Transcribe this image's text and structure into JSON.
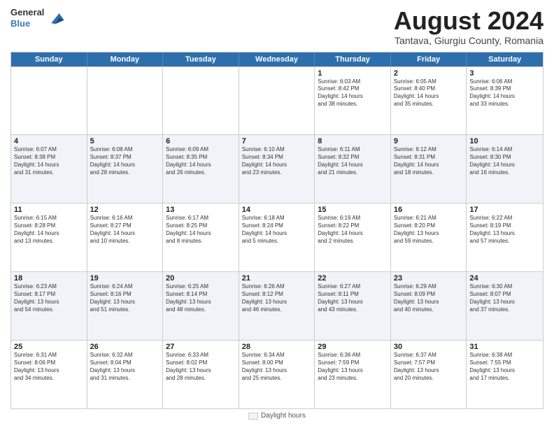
{
  "header": {
    "logo_general": "General",
    "logo_blue": "Blue",
    "title": "August 2024",
    "location": "Tantava, Giurgiu County, Romania"
  },
  "weekdays": [
    "Sunday",
    "Monday",
    "Tuesday",
    "Wednesday",
    "Thursday",
    "Friday",
    "Saturday"
  ],
  "rows": [
    [
      {
        "day": "",
        "text": ""
      },
      {
        "day": "",
        "text": ""
      },
      {
        "day": "",
        "text": ""
      },
      {
        "day": "",
        "text": ""
      },
      {
        "day": "1",
        "text": "Sunrise: 6:03 AM\nSunset: 8:42 PM\nDaylight: 14 hours\nand 38 minutes."
      },
      {
        "day": "2",
        "text": "Sunrise: 6:05 AM\nSunset: 8:40 PM\nDaylight: 14 hours\nand 35 minutes."
      },
      {
        "day": "3",
        "text": "Sunrise: 6:06 AM\nSunset: 8:39 PM\nDaylight: 14 hours\nand 33 minutes."
      }
    ],
    [
      {
        "day": "4",
        "text": "Sunrise: 6:07 AM\nSunset: 8:38 PM\nDaylight: 14 hours\nand 31 minutes."
      },
      {
        "day": "5",
        "text": "Sunrise: 6:08 AM\nSunset: 8:37 PM\nDaylight: 14 hours\nand 28 minutes."
      },
      {
        "day": "6",
        "text": "Sunrise: 6:09 AM\nSunset: 8:35 PM\nDaylight: 14 hours\nand 26 minutes."
      },
      {
        "day": "7",
        "text": "Sunrise: 6:10 AM\nSunset: 8:34 PM\nDaylight: 14 hours\nand 23 minutes."
      },
      {
        "day": "8",
        "text": "Sunrise: 6:11 AM\nSunset: 8:32 PM\nDaylight: 14 hours\nand 21 minutes."
      },
      {
        "day": "9",
        "text": "Sunrise: 6:12 AM\nSunset: 8:31 PM\nDaylight: 14 hours\nand 18 minutes."
      },
      {
        "day": "10",
        "text": "Sunrise: 6:14 AM\nSunset: 8:30 PM\nDaylight: 14 hours\nand 16 minutes."
      }
    ],
    [
      {
        "day": "11",
        "text": "Sunrise: 6:15 AM\nSunset: 8:28 PM\nDaylight: 14 hours\nand 13 minutes."
      },
      {
        "day": "12",
        "text": "Sunrise: 6:16 AM\nSunset: 8:27 PM\nDaylight: 14 hours\nand 10 minutes."
      },
      {
        "day": "13",
        "text": "Sunrise: 6:17 AM\nSunset: 8:25 PM\nDaylight: 14 hours\nand 8 minutes."
      },
      {
        "day": "14",
        "text": "Sunrise: 6:18 AM\nSunset: 8:24 PM\nDaylight: 14 hours\nand 5 minutes."
      },
      {
        "day": "15",
        "text": "Sunrise: 6:19 AM\nSunset: 8:22 PM\nDaylight: 14 hours\nand 2 minutes."
      },
      {
        "day": "16",
        "text": "Sunrise: 6:21 AM\nSunset: 8:20 PM\nDaylight: 13 hours\nand 59 minutes."
      },
      {
        "day": "17",
        "text": "Sunrise: 6:22 AM\nSunset: 8:19 PM\nDaylight: 13 hours\nand 57 minutes."
      }
    ],
    [
      {
        "day": "18",
        "text": "Sunrise: 6:23 AM\nSunset: 8:17 PM\nDaylight: 13 hours\nand 54 minutes."
      },
      {
        "day": "19",
        "text": "Sunrise: 6:24 AM\nSunset: 8:16 PM\nDaylight: 13 hours\nand 51 minutes."
      },
      {
        "day": "20",
        "text": "Sunrise: 6:25 AM\nSunset: 8:14 PM\nDaylight: 13 hours\nand 48 minutes."
      },
      {
        "day": "21",
        "text": "Sunrise: 6:26 AM\nSunset: 8:12 PM\nDaylight: 13 hours\nand 46 minutes."
      },
      {
        "day": "22",
        "text": "Sunrise: 6:27 AM\nSunset: 8:11 PM\nDaylight: 13 hours\nand 43 minutes."
      },
      {
        "day": "23",
        "text": "Sunrise: 6:29 AM\nSunset: 8:09 PM\nDaylight: 13 hours\nand 40 minutes."
      },
      {
        "day": "24",
        "text": "Sunrise: 6:30 AM\nSunset: 8:07 PM\nDaylight: 13 hours\nand 37 minutes."
      }
    ],
    [
      {
        "day": "25",
        "text": "Sunrise: 6:31 AM\nSunset: 8:06 PM\nDaylight: 13 hours\nand 34 minutes."
      },
      {
        "day": "26",
        "text": "Sunrise: 6:32 AM\nSunset: 8:04 PM\nDaylight: 13 hours\nand 31 minutes."
      },
      {
        "day": "27",
        "text": "Sunrise: 6:33 AM\nSunset: 8:02 PM\nDaylight: 13 hours\nand 28 minutes."
      },
      {
        "day": "28",
        "text": "Sunrise: 6:34 AM\nSunset: 8:00 PM\nDaylight: 13 hours\nand 25 minutes."
      },
      {
        "day": "29",
        "text": "Sunrise: 6:36 AM\nSunset: 7:59 PM\nDaylight: 13 hours\nand 23 minutes."
      },
      {
        "day": "30",
        "text": "Sunrise: 6:37 AM\nSunset: 7:57 PM\nDaylight: 13 hours\nand 20 minutes."
      },
      {
        "day": "31",
        "text": "Sunrise: 6:38 AM\nSunset: 7:55 PM\nDaylight: 13 hours\nand 17 minutes."
      }
    ]
  ],
  "footer": {
    "legend_label": "Daylight hours"
  }
}
